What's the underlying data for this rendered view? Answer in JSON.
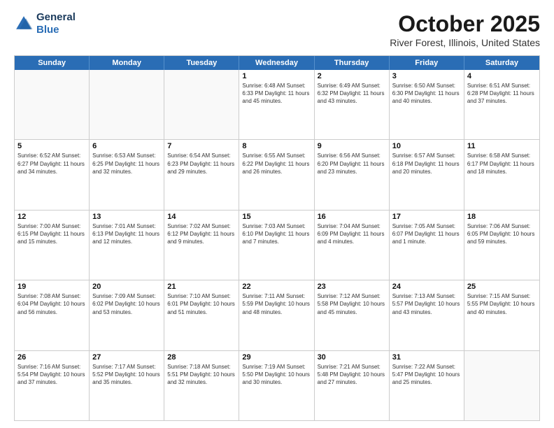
{
  "header": {
    "logo_line1": "General",
    "logo_line2": "Blue",
    "month": "October 2025",
    "location": "River Forest, Illinois, United States"
  },
  "day_headers": [
    "Sunday",
    "Monday",
    "Tuesday",
    "Wednesday",
    "Thursday",
    "Friday",
    "Saturday"
  ],
  "weeks": [
    [
      {
        "day": "",
        "empty": true
      },
      {
        "day": "",
        "empty": true
      },
      {
        "day": "",
        "empty": true
      },
      {
        "day": "1",
        "info": "Sunrise: 6:48 AM\nSunset: 6:33 PM\nDaylight: 11 hours\nand 45 minutes."
      },
      {
        "day": "2",
        "info": "Sunrise: 6:49 AM\nSunset: 6:32 PM\nDaylight: 11 hours\nand 43 minutes."
      },
      {
        "day": "3",
        "info": "Sunrise: 6:50 AM\nSunset: 6:30 PM\nDaylight: 11 hours\nand 40 minutes."
      },
      {
        "day": "4",
        "info": "Sunrise: 6:51 AM\nSunset: 6:28 PM\nDaylight: 11 hours\nand 37 minutes."
      }
    ],
    [
      {
        "day": "5",
        "info": "Sunrise: 6:52 AM\nSunset: 6:27 PM\nDaylight: 11 hours\nand 34 minutes."
      },
      {
        "day": "6",
        "info": "Sunrise: 6:53 AM\nSunset: 6:25 PM\nDaylight: 11 hours\nand 32 minutes."
      },
      {
        "day": "7",
        "info": "Sunrise: 6:54 AM\nSunset: 6:23 PM\nDaylight: 11 hours\nand 29 minutes."
      },
      {
        "day": "8",
        "info": "Sunrise: 6:55 AM\nSunset: 6:22 PM\nDaylight: 11 hours\nand 26 minutes."
      },
      {
        "day": "9",
        "info": "Sunrise: 6:56 AM\nSunset: 6:20 PM\nDaylight: 11 hours\nand 23 minutes."
      },
      {
        "day": "10",
        "info": "Sunrise: 6:57 AM\nSunset: 6:18 PM\nDaylight: 11 hours\nand 20 minutes."
      },
      {
        "day": "11",
        "info": "Sunrise: 6:58 AM\nSunset: 6:17 PM\nDaylight: 11 hours\nand 18 minutes."
      }
    ],
    [
      {
        "day": "12",
        "info": "Sunrise: 7:00 AM\nSunset: 6:15 PM\nDaylight: 11 hours\nand 15 minutes."
      },
      {
        "day": "13",
        "info": "Sunrise: 7:01 AM\nSunset: 6:13 PM\nDaylight: 11 hours\nand 12 minutes."
      },
      {
        "day": "14",
        "info": "Sunrise: 7:02 AM\nSunset: 6:12 PM\nDaylight: 11 hours\nand 9 minutes."
      },
      {
        "day": "15",
        "info": "Sunrise: 7:03 AM\nSunset: 6:10 PM\nDaylight: 11 hours\nand 7 minutes."
      },
      {
        "day": "16",
        "info": "Sunrise: 7:04 AM\nSunset: 6:09 PM\nDaylight: 11 hours\nand 4 minutes."
      },
      {
        "day": "17",
        "info": "Sunrise: 7:05 AM\nSunset: 6:07 PM\nDaylight: 11 hours\nand 1 minute."
      },
      {
        "day": "18",
        "info": "Sunrise: 7:06 AM\nSunset: 6:05 PM\nDaylight: 10 hours\nand 59 minutes."
      }
    ],
    [
      {
        "day": "19",
        "info": "Sunrise: 7:08 AM\nSunset: 6:04 PM\nDaylight: 10 hours\nand 56 minutes."
      },
      {
        "day": "20",
        "info": "Sunrise: 7:09 AM\nSunset: 6:02 PM\nDaylight: 10 hours\nand 53 minutes."
      },
      {
        "day": "21",
        "info": "Sunrise: 7:10 AM\nSunset: 6:01 PM\nDaylight: 10 hours\nand 51 minutes."
      },
      {
        "day": "22",
        "info": "Sunrise: 7:11 AM\nSunset: 5:59 PM\nDaylight: 10 hours\nand 48 minutes."
      },
      {
        "day": "23",
        "info": "Sunrise: 7:12 AM\nSunset: 5:58 PM\nDaylight: 10 hours\nand 45 minutes."
      },
      {
        "day": "24",
        "info": "Sunrise: 7:13 AM\nSunset: 5:57 PM\nDaylight: 10 hours\nand 43 minutes."
      },
      {
        "day": "25",
        "info": "Sunrise: 7:15 AM\nSunset: 5:55 PM\nDaylight: 10 hours\nand 40 minutes."
      }
    ],
    [
      {
        "day": "26",
        "info": "Sunrise: 7:16 AM\nSunset: 5:54 PM\nDaylight: 10 hours\nand 37 minutes."
      },
      {
        "day": "27",
        "info": "Sunrise: 7:17 AM\nSunset: 5:52 PM\nDaylight: 10 hours\nand 35 minutes."
      },
      {
        "day": "28",
        "info": "Sunrise: 7:18 AM\nSunset: 5:51 PM\nDaylight: 10 hours\nand 32 minutes."
      },
      {
        "day": "29",
        "info": "Sunrise: 7:19 AM\nSunset: 5:50 PM\nDaylight: 10 hours\nand 30 minutes."
      },
      {
        "day": "30",
        "info": "Sunrise: 7:21 AM\nSunset: 5:48 PM\nDaylight: 10 hours\nand 27 minutes."
      },
      {
        "day": "31",
        "info": "Sunrise: 7:22 AM\nSunset: 5:47 PM\nDaylight: 10 hours\nand 25 minutes."
      },
      {
        "day": "",
        "empty": true
      }
    ]
  ]
}
